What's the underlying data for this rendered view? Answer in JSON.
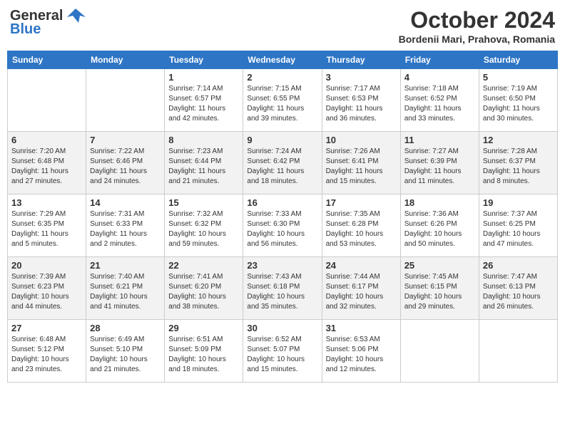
{
  "header": {
    "logo_general": "General",
    "logo_blue": "Blue",
    "month_title": "October 2024",
    "location": "Bordenii Mari, Prahova, Romania"
  },
  "days_of_week": [
    "Sunday",
    "Monday",
    "Tuesday",
    "Wednesday",
    "Thursday",
    "Friday",
    "Saturday"
  ],
  "weeks": [
    [
      {
        "day": "",
        "sunrise": "",
        "sunset": "",
        "daylight": ""
      },
      {
        "day": "",
        "sunrise": "",
        "sunset": "",
        "daylight": ""
      },
      {
        "day": "1",
        "sunrise": "Sunrise: 7:14 AM",
        "sunset": "Sunset: 6:57 PM",
        "daylight": "Daylight: 11 hours and 42 minutes."
      },
      {
        "day": "2",
        "sunrise": "Sunrise: 7:15 AM",
        "sunset": "Sunset: 6:55 PM",
        "daylight": "Daylight: 11 hours and 39 minutes."
      },
      {
        "day": "3",
        "sunrise": "Sunrise: 7:17 AM",
        "sunset": "Sunset: 6:53 PM",
        "daylight": "Daylight: 11 hours and 36 minutes."
      },
      {
        "day": "4",
        "sunrise": "Sunrise: 7:18 AM",
        "sunset": "Sunset: 6:52 PM",
        "daylight": "Daylight: 11 hours and 33 minutes."
      },
      {
        "day": "5",
        "sunrise": "Sunrise: 7:19 AM",
        "sunset": "Sunset: 6:50 PM",
        "daylight": "Daylight: 11 hours and 30 minutes."
      }
    ],
    [
      {
        "day": "6",
        "sunrise": "Sunrise: 7:20 AM",
        "sunset": "Sunset: 6:48 PM",
        "daylight": "Daylight: 11 hours and 27 minutes."
      },
      {
        "day": "7",
        "sunrise": "Sunrise: 7:22 AM",
        "sunset": "Sunset: 6:46 PM",
        "daylight": "Daylight: 11 hours and 24 minutes."
      },
      {
        "day": "8",
        "sunrise": "Sunrise: 7:23 AM",
        "sunset": "Sunset: 6:44 PM",
        "daylight": "Daylight: 11 hours and 21 minutes."
      },
      {
        "day": "9",
        "sunrise": "Sunrise: 7:24 AM",
        "sunset": "Sunset: 6:42 PM",
        "daylight": "Daylight: 11 hours and 18 minutes."
      },
      {
        "day": "10",
        "sunrise": "Sunrise: 7:26 AM",
        "sunset": "Sunset: 6:41 PM",
        "daylight": "Daylight: 11 hours and 15 minutes."
      },
      {
        "day": "11",
        "sunrise": "Sunrise: 7:27 AM",
        "sunset": "Sunset: 6:39 PM",
        "daylight": "Daylight: 11 hours and 11 minutes."
      },
      {
        "day": "12",
        "sunrise": "Sunrise: 7:28 AM",
        "sunset": "Sunset: 6:37 PM",
        "daylight": "Daylight: 11 hours and 8 minutes."
      }
    ],
    [
      {
        "day": "13",
        "sunrise": "Sunrise: 7:29 AM",
        "sunset": "Sunset: 6:35 PM",
        "daylight": "Daylight: 11 hours and 5 minutes."
      },
      {
        "day": "14",
        "sunrise": "Sunrise: 7:31 AM",
        "sunset": "Sunset: 6:33 PM",
        "daylight": "Daylight: 11 hours and 2 minutes."
      },
      {
        "day": "15",
        "sunrise": "Sunrise: 7:32 AM",
        "sunset": "Sunset: 6:32 PM",
        "daylight": "Daylight: 10 hours and 59 minutes."
      },
      {
        "day": "16",
        "sunrise": "Sunrise: 7:33 AM",
        "sunset": "Sunset: 6:30 PM",
        "daylight": "Daylight: 10 hours and 56 minutes."
      },
      {
        "day": "17",
        "sunrise": "Sunrise: 7:35 AM",
        "sunset": "Sunset: 6:28 PM",
        "daylight": "Daylight: 10 hours and 53 minutes."
      },
      {
        "day": "18",
        "sunrise": "Sunrise: 7:36 AM",
        "sunset": "Sunset: 6:26 PM",
        "daylight": "Daylight: 10 hours and 50 minutes."
      },
      {
        "day": "19",
        "sunrise": "Sunrise: 7:37 AM",
        "sunset": "Sunset: 6:25 PM",
        "daylight": "Daylight: 10 hours and 47 minutes."
      }
    ],
    [
      {
        "day": "20",
        "sunrise": "Sunrise: 7:39 AM",
        "sunset": "Sunset: 6:23 PM",
        "daylight": "Daylight: 10 hours and 44 minutes."
      },
      {
        "day": "21",
        "sunrise": "Sunrise: 7:40 AM",
        "sunset": "Sunset: 6:21 PM",
        "daylight": "Daylight: 10 hours and 41 minutes."
      },
      {
        "day": "22",
        "sunrise": "Sunrise: 7:41 AM",
        "sunset": "Sunset: 6:20 PM",
        "daylight": "Daylight: 10 hours and 38 minutes."
      },
      {
        "day": "23",
        "sunrise": "Sunrise: 7:43 AM",
        "sunset": "Sunset: 6:18 PM",
        "daylight": "Daylight: 10 hours and 35 minutes."
      },
      {
        "day": "24",
        "sunrise": "Sunrise: 7:44 AM",
        "sunset": "Sunset: 6:17 PM",
        "daylight": "Daylight: 10 hours and 32 minutes."
      },
      {
        "day": "25",
        "sunrise": "Sunrise: 7:45 AM",
        "sunset": "Sunset: 6:15 PM",
        "daylight": "Daylight: 10 hours and 29 minutes."
      },
      {
        "day": "26",
        "sunrise": "Sunrise: 7:47 AM",
        "sunset": "Sunset: 6:13 PM",
        "daylight": "Daylight: 10 hours and 26 minutes."
      }
    ],
    [
      {
        "day": "27",
        "sunrise": "Sunrise: 6:48 AM",
        "sunset": "Sunset: 5:12 PM",
        "daylight": "Daylight: 10 hours and 23 minutes."
      },
      {
        "day": "28",
        "sunrise": "Sunrise: 6:49 AM",
        "sunset": "Sunset: 5:10 PM",
        "daylight": "Daylight: 10 hours and 21 minutes."
      },
      {
        "day": "29",
        "sunrise": "Sunrise: 6:51 AM",
        "sunset": "Sunset: 5:09 PM",
        "daylight": "Daylight: 10 hours and 18 minutes."
      },
      {
        "day": "30",
        "sunrise": "Sunrise: 6:52 AM",
        "sunset": "Sunset: 5:07 PM",
        "daylight": "Daylight: 10 hours and 15 minutes."
      },
      {
        "day": "31",
        "sunrise": "Sunrise: 6:53 AM",
        "sunset": "Sunset: 5:06 PM",
        "daylight": "Daylight: 10 hours and 12 minutes."
      },
      {
        "day": "",
        "sunrise": "",
        "sunset": "",
        "daylight": ""
      },
      {
        "day": "",
        "sunrise": "",
        "sunset": "",
        "daylight": ""
      }
    ]
  ]
}
